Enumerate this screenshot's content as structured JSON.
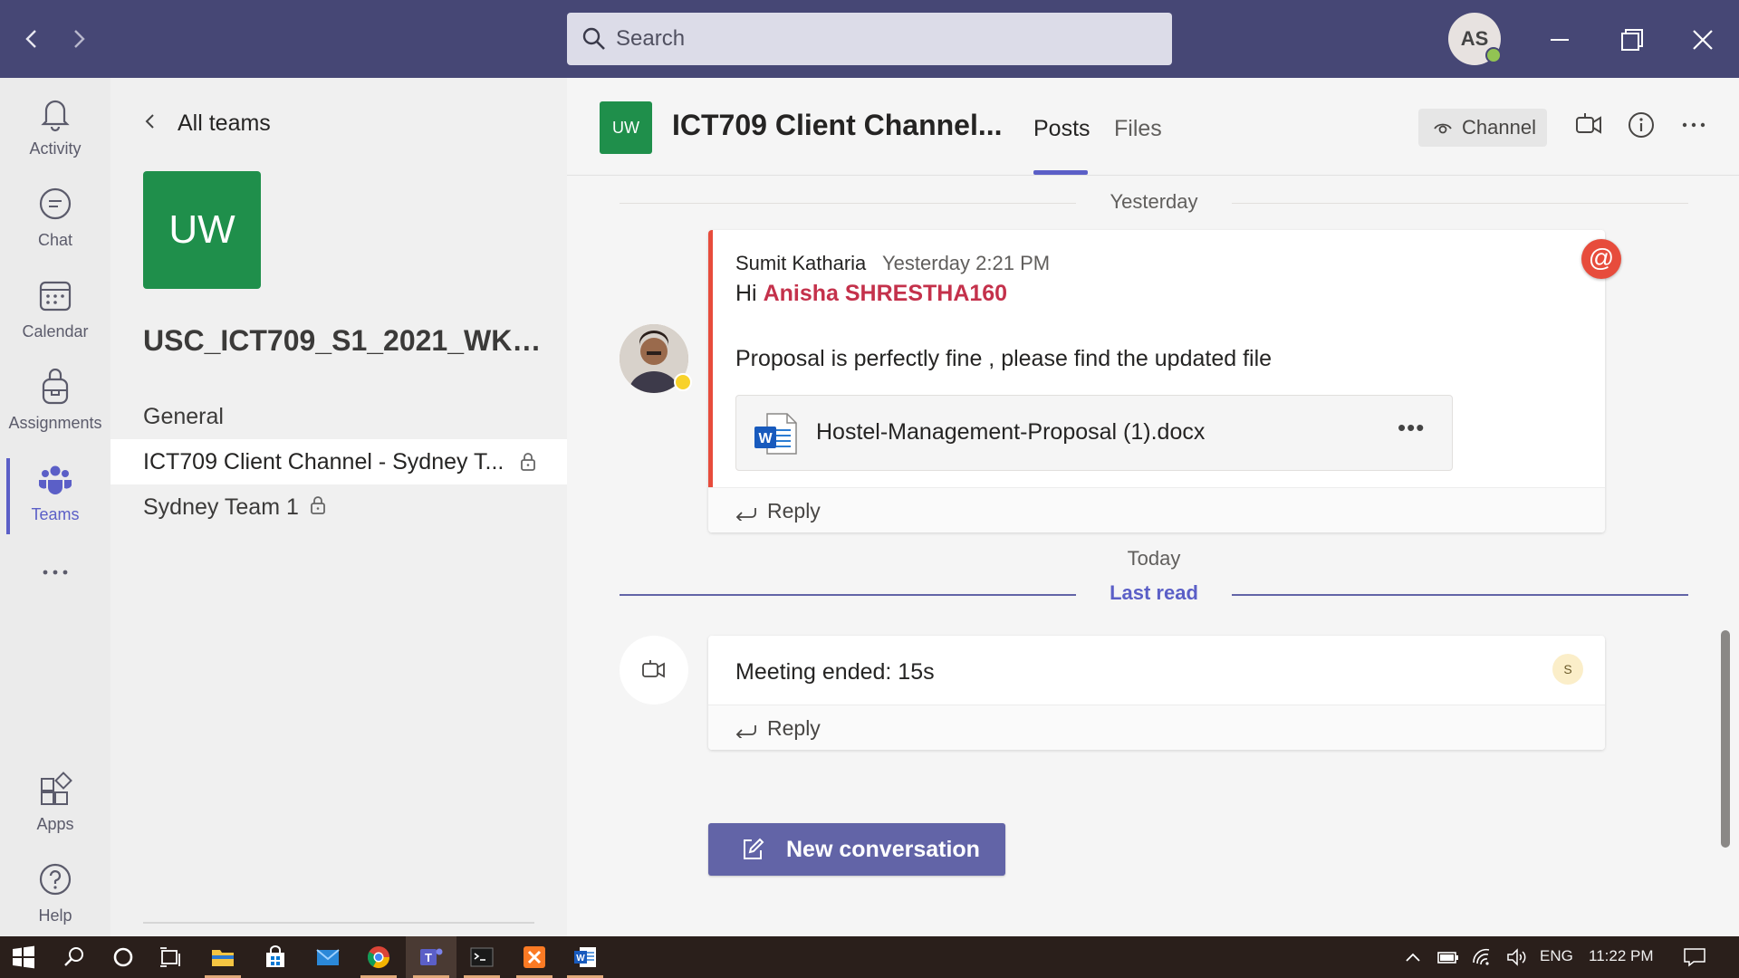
{
  "search": {
    "placeholder": "Search"
  },
  "profile": {
    "initials": "AS",
    "presence": "available"
  },
  "rail": {
    "items": [
      {
        "label": "Activity",
        "icon": "bell-icon"
      },
      {
        "label": "Chat",
        "icon": "chat-icon"
      },
      {
        "label": "Calendar",
        "icon": "calendar-icon"
      },
      {
        "label": "Assignments",
        "icon": "backpack-icon"
      },
      {
        "label": "Teams",
        "icon": "teams-icon",
        "active": true
      },
      {
        "label": "Apps",
        "icon": "apps-icon"
      },
      {
        "label": "Help",
        "icon": "help-icon"
      }
    ]
  },
  "team_pane": {
    "back_label": "All teams",
    "team_initials": "UW",
    "team_name": "USC_ICT709_S1_2021_WKS_...",
    "channels": [
      {
        "label": "General",
        "private": false
      },
      {
        "label": "ICT709 Client Channel - Sydney T...",
        "private": true,
        "active": true
      },
      {
        "label": "Sydney Team 1",
        "private": true
      }
    ]
  },
  "channel_header": {
    "initials": "UW",
    "title": "ICT709 Client Channel...",
    "tabs": [
      {
        "label": "Posts",
        "active": true
      },
      {
        "label": "Files"
      }
    ],
    "channel_button": "Channel"
  },
  "feed": {
    "divider_yesterday": "Yesterday",
    "post": {
      "author": "Sumit Katharia",
      "time": "Yesterday 2:21 PM",
      "greeting": "Hi",
      "mention": "Anisha SHRESTHA160",
      "body": "Proposal is perfectly fine , please find the updated file",
      "attachment": {
        "filename": "Hostel-Management-Proposal (1).docx",
        "type": "word-icon"
      },
      "reply_label": "Reply",
      "mention_badge": "@"
    },
    "divider_today": "Today",
    "last_read": "Last read",
    "meeting": {
      "title": "Meeting ended: 15s",
      "participant_initial": "S",
      "reply_label": "Reply"
    },
    "new_conversation": "New conversation"
  },
  "taskbar": {
    "language": "ENG",
    "time": "11:22 PM"
  },
  "colors": {
    "titlebar": "#464775",
    "accent": "#6264a7",
    "team_tile": "#1f8f4b",
    "mention": "#c4314b"
  }
}
